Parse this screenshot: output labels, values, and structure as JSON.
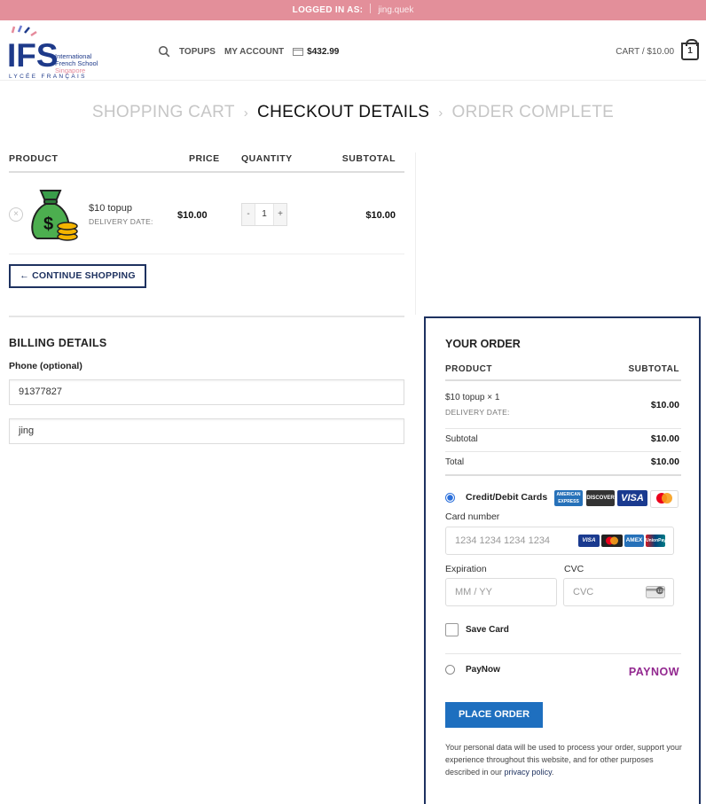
{
  "topbar": {
    "label": "LOGGED IN AS:",
    "user": "jing.quek"
  },
  "header": {
    "logo_text": "IFS",
    "logo_line1": "International",
    "logo_line2": "French School",
    "logo_line3": "Singapore",
    "logo_sub": "LYCÉE FRANÇAIS",
    "nav": {
      "topups": "TOPUPS",
      "account": "MY ACCOUNT",
      "balance": "$432.99"
    },
    "cart": {
      "label": "CART / $10.00",
      "count": "1"
    }
  },
  "steps": {
    "cart": "SHOPPING CART",
    "checkout": "CHECKOUT DETAILS",
    "complete": "ORDER COMPLETE",
    "arrow": "›"
  },
  "cart_table": {
    "headers": {
      "product": "PRODUCT",
      "price": "PRICE",
      "quantity": "QUANTITY",
      "subtotal": "SUBTOTAL"
    },
    "item": {
      "name": "$10 topup",
      "meta": "DELIVERY DATE:",
      "price": "$10.00",
      "qty": "1",
      "subtotal": "$10.00",
      "remove": "×",
      "minus": "-",
      "plus": "+"
    },
    "continue": "← CONTINUE SHOPPING"
  },
  "billing": {
    "title": "BILLING DETAILS",
    "phone_label": "Phone (optional)",
    "phone": "91377827",
    "name": "jing"
  },
  "order": {
    "title": "YOUR ORDER",
    "head_product": "PRODUCT",
    "head_subtotal": "SUBTOTAL",
    "item": "$10 topup  × 1",
    "item_meta": "DELIVERY DATE:",
    "item_total": "$10.00",
    "subtotal_label": "Subtotal",
    "subtotal": "$10.00",
    "total_label": "Total",
    "total": "$10.00",
    "card_label": "Credit/Debit Cards",
    "card_badges": {
      "amex": "AMERICAN EXPRESS",
      "discover": "DISCOVER",
      "visa": "VISA"
    },
    "card_number_label": "Card number",
    "card_number_placeholder": "1234 1234 1234 1234",
    "mini_badges": {
      "visa": "VISA",
      "amex": "AMEX",
      "union": "UnionPay"
    },
    "expiration_label": "Expiration",
    "expiration_placeholder": "MM / YY",
    "cvc_label": "CVC",
    "cvc_placeholder": "CVC",
    "save_card": "Save Card",
    "paynow_label": "PayNow",
    "paynow_logo": "PAYNOW",
    "place_order": "PLACE ORDER",
    "privacy_text": "Your personal data will be used to process your order, support your experience throughout this website, and for other purposes described in our ",
    "privacy_link": "privacy policy",
    "privacy_end": "."
  },
  "colors": {
    "topbar": "#e38f9a",
    "navy": "#1e3260",
    "button_blue": "#1e6fbf",
    "paynow": "#92278f",
    "radio": "#2a6fdb"
  }
}
